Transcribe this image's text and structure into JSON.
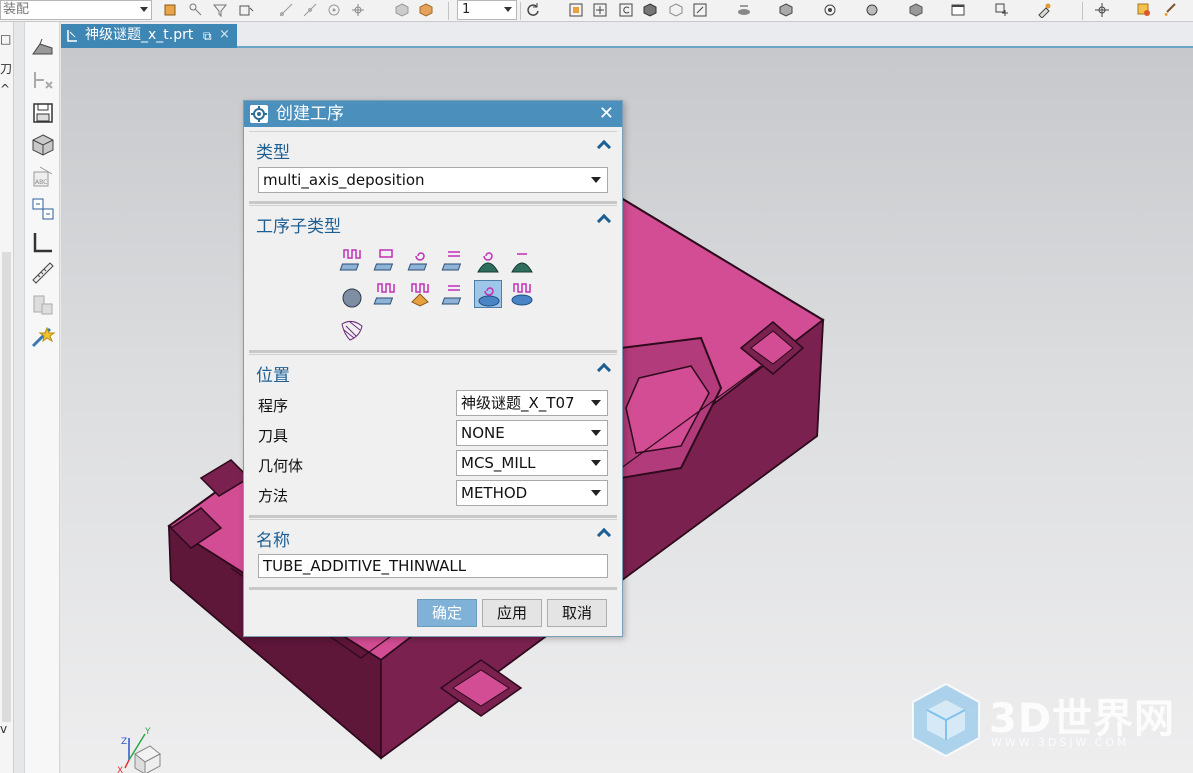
{
  "toolbar": {
    "selection_filter": "装配",
    "layer_value": "1"
  },
  "left_panel": {
    "glyph_top": "□",
    "glyph_mid": "刀",
    "glyph_caret_up": "^",
    "glyph_caret_down": "v"
  },
  "tab": {
    "label": "神级谜题_x_t.prt",
    "close": "×"
  },
  "dialog": {
    "title": "创建工序",
    "close": "✕",
    "type_section": {
      "title": "类型",
      "value": "multi_axis_deposition"
    },
    "subtype_section": {
      "title": "工序子类型",
      "icons": [
        "planar-zigzag-deposition-icon",
        "planar-offset-deposition-icon",
        "planar-spiral-deposition-icon",
        "planar-contour-deposition-icon",
        "dome-spiral-deposition-icon",
        "dome-contour-deposition-icon",
        "sphere-deposition-icon",
        "variable-zigzag-deposition-icon",
        "feature-deposition-icon",
        "surface-contour-deposition-icon",
        "tube-thinwall-deposition-icon",
        "tube-additive-deposition-icon",
        "mesh-deposition-icon"
      ],
      "selected_index": 10
    },
    "location_section": {
      "title": "位置",
      "rows": [
        {
          "label": "程序",
          "value": "神级谜题_X_T07"
        },
        {
          "label": "刀具",
          "value": "NONE"
        },
        {
          "label": "几何体",
          "value": "MCS_MILL"
        },
        {
          "label": "方法",
          "value": "METHOD"
        }
      ]
    },
    "name_section": {
      "title": "名称",
      "value": "TUBE_ADDITIVE_THINWALL"
    },
    "buttons": {
      "ok": "确定",
      "apply": "应用",
      "cancel": "取消"
    }
  },
  "watermark": {
    "title": "3D世界网",
    "subtitle": "WWW.3DSJW.COM"
  },
  "triad": {
    "x": "X",
    "y": "Y",
    "z": "Z"
  },
  "colors": {
    "model_top": "#d24d93",
    "model_side": "#6e1d45",
    "title_bar": "#4b8fbd",
    "section_header": "#1e5f93",
    "primary_button": "#7fb2d6"
  }
}
